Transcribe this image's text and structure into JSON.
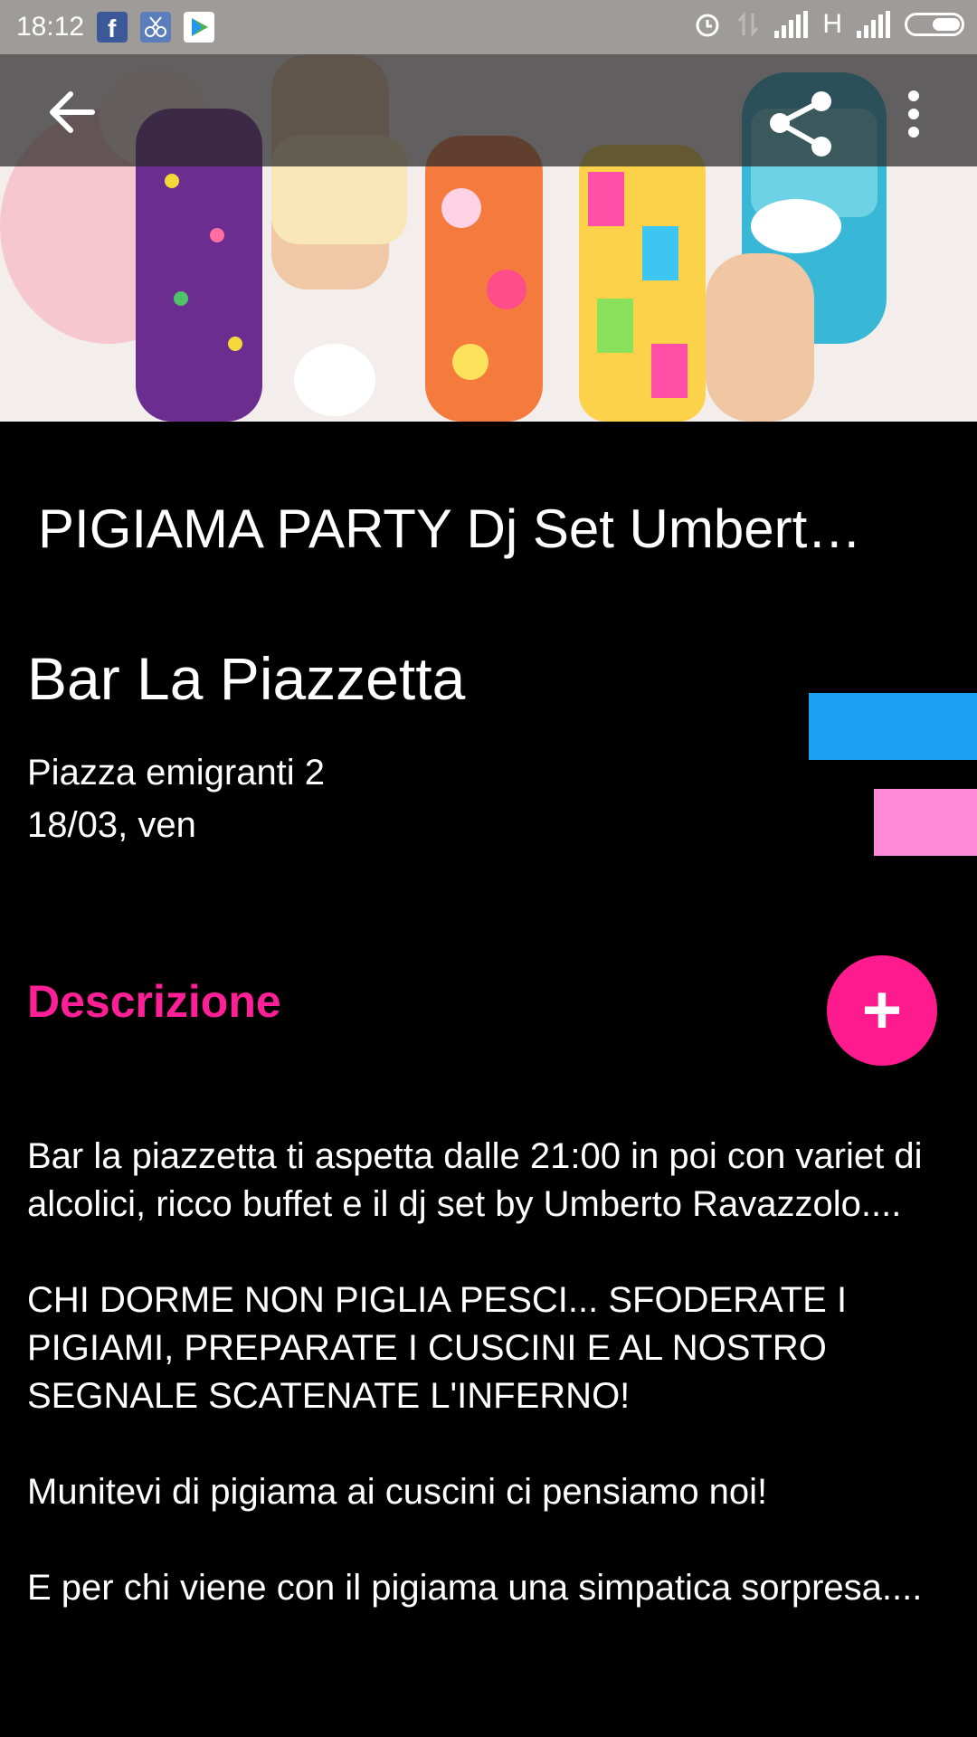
{
  "status_bar": {
    "time": "18:12",
    "network_type": "H",
    "left_icons": [
      "facebook-icon",
      "scissors-app-icon",
      "play-store-icon"
    ],
    "right_icons": [
      "alarm-icon",
      "data-arrows-icon",
      "signal-icon",
      "signal-icon",
      "battery-icon"
    ]
  },
  "app_bar": {
    "back_icon": "arrow-back-icon",
    "share_icon": "share-icon",
    "more_icon": "more-vert-icon"
  },
  "event": {
    "title": "PIGIAMA PARTY Dj Set Umbert…",
    "venue": "Bar La Piazzetta",
    "address": "Piazza emigranti 2",
    "date": "18/03, ven"
  },
  "tags": {
    "blue_color": "#1ba1f2",
    "pink_color": "#ff8ad8"
  },
  "description": {
    "heading": "Descrizione",
    "heading_color": "#ff1f96",
    "fab_label": "+",
    "paragraphs": [
      "Bar la piazzetta ti aspetta dalle 21:00 in poi con variet di alcolici, ricco buffet e il dj set by Umberto Ravazzolo....",
      "CHI DORME NON PIGLIA PESCI... SFODERATE I PIGIAMI, PREPARATE I CUSCINI E AL NOSTRO SEGNALE SCATENATE L'INFERNO!",
      "Munitevi di pigiama ai cuscini ci pensiamo noi!",
      "E per chi viene con il pigiama una simpatica sorpresa...."
    ]
  }
}
